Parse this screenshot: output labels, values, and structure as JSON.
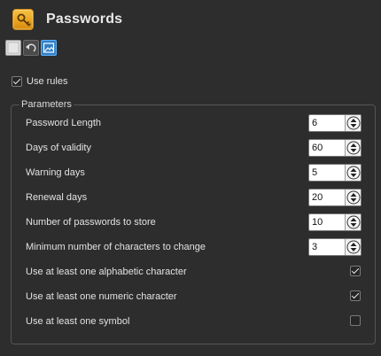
{
  "app": {
    "title": "Passwords",
    "icon": "key-icon",
    "accent_color": "#e8a21f"
  },
  "toolbar": {
    "buttons": [
      {
        "name": "blank-button",
        "icon": "blank-square-icon"
      },
      {
        "name": "undo-button",
        "icon": "undo-icon"
      },
      {
        "name": "image-button",
        "icon": "image-icon",
        "active": true
      }
    ]
  },
  "use_rules": {
    "label": "Use rules",
    "checked": true
  },
  "parameters": {
    "title": "Parameters",
    "spin_fields": [
      {
        "label": "Password Length",
        "value": "6"
      },
      {
        "label": "Days of validity",
        "value": "60"
      },
      {
        "label": "Warning days",
        "value": "5"
      },
      {
        "label": "Renewal days",
        "value": "20"
      },
      {
        "label": "Number of passwords to store",
        "value": "10"
      },
      {
        "label": "Minimum number of characters to change",
        "value": "3"
      }
    ],
    "check_fields": [
      {
        "label": "Use at least one alphabetic character",
        "checked": true
      },
      {
        "label": "Use at least one numeric character",
        "checked": true
      },
      {
        "label": "Use at least one symbol",
        "checked": false
      }
    ]
  }
}
